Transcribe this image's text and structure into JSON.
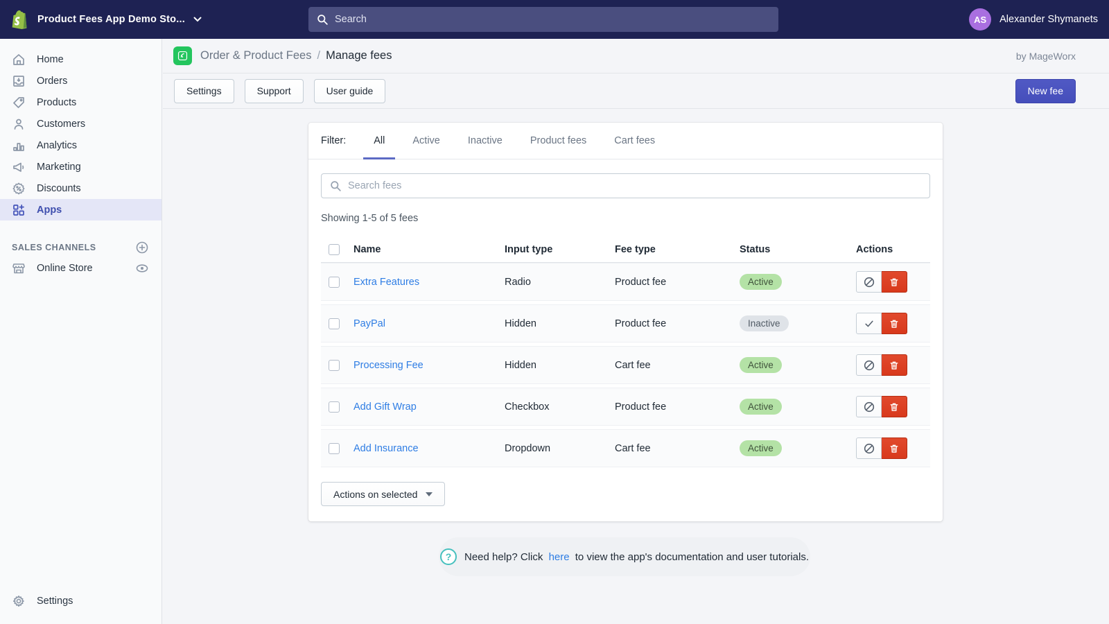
{
  "topbar": {
    "store_name": "Product Fees App Demo Sto...",
    "search_placeholder": "Search",
    "user_initials": "AS",
    "user_name": "Alexander Shymanets"
  },
  "sidebar": {
    "items": [
      {
        "label": "Home"
      },
      {
        "label": "Orders"
      },
      {
        "label": "Products"
      },
      {
        "label": "Customers"
      },
      {
        "label": "Analytics"
      },
      {
        "label": "Marketing"
      },
      {
        "label": "Discounts"
      },
      {
        "label": "Apps",
        "active": true
      }
    ],
    "sales_channels_label": "SALES CHANNELS",
    "online_store_label": "Online Store",
    "settings_label": "Settings"
  },
  "header": {
    "app_name": "Order & Product Fees",
    "separator": "/",
    "page_title": "Manage fees",
    "byline": "by MageWorx"
  },
  "toolbar": {
    "settings_label": "Settings",
    "support_label": "Support",
    "user_guide_label": "User guide",
    "new_fee_label": "New fee"
  },
  "card": {
    "filter_label": "Filter:",
    "tabs": [
      {
        "label": "All",
        "active": true
      },
      {
        "label": "Active",
        "active": false
      },
      {
        "label": "Inactive",
        "active": false
      },
      {
        "label": "Product fees",
        "active": false
      },
      {
        "label": "Cart fees",
        "active": false
      }
    ],
    "search_placeholder": "Search fees",
    "showing_text": "Showing 1-5 of 5 fees",
    "table": {
      "headers": {
        "name": "Name",
        "input_type": "Input type",
        "fee_type": "Fee type",
        "status": "Status",
        "actions": "Actions"
      },
      "rows": [
        {
          "name": "Extra Features",
          "input_type": "Radio",
          "fee_type": "Product fee",
          "status": "Active",
          "toggle_icon": "disable-icon"
        },
        {
          "name": "PayPal",
          "input_type": "Hidden",
          "fee_type": "Product fee",
          "status": "Inactive",
          "toggle_icon": "enable-icon"
        },
        {
          "name": "Processing Fee",
          "input_type": "Hidden",
          "fee_type": "Cart fee",
          "status": "Active",
          "toggle_icon": "disable-icon"
        },
        {
          "name": "Add Gift Wrap",
          "input_type": "Checkbox",
          "fee_type": "Product fee",
          "status": "Active",
          "toggle_icon": "disable-icon"
        },
        {
          "name": "Add Insurance",
          "input_type": "Dropdown",
          "fee_type": "Cart fee",
          "status": "Active",
          "toggle_icon": "disable-icon"
        }
      ]
    },
    "bulk_button_label": "Actions on selected"
  },
  "footer": {
    "question_mark": "?",
    "text_before": "Need help? Click",
    "link_text": "here",
    "text_after": "to view the app's documentation and user tutorials."
  },
  "colors": {
    "topbar_bg": "#1e2253",
    "topbar_search_bg": "#4a4e7f",
    "avatar_bg": "#a96fe0",
    "sidebar_active_bg": "#e4e6f7",
    "sidebar_active_text": "#3f4fae",
    "app_icon_green": "#24c55e",
    "primary_button": "#4a54c0",
    "tab_underline": "#5c6ac4",
    "link_blue": "#2e7de4",
    "badge_active_bg": "#b4e2a6",
    "badge_inactive_bg": "#dfe3e8",
    "delete_red": "#dc3e20",
    "help_icon_teal": "#45c0be"
  }
}
